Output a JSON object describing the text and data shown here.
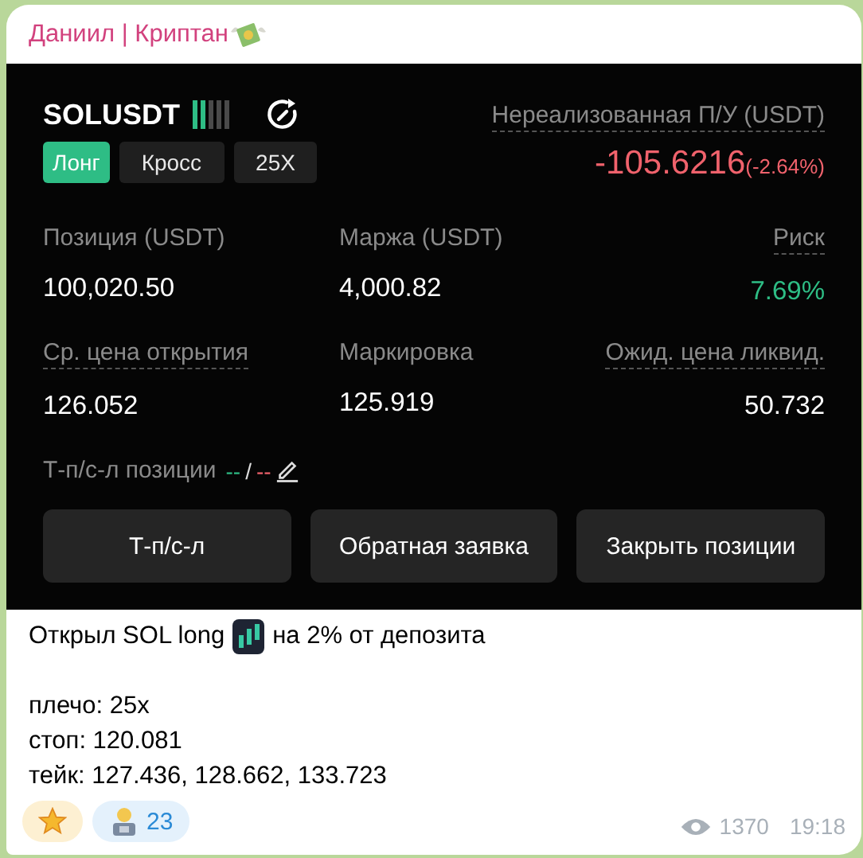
{
  "channel": {
    "name": "Даниил | Криптан"
  },
  "position": {
    "symbol": "SOLUSDT",
    "level": 0.4,
    "tags": [
      {
        "label": "Лонг",
        "kind": "side"
      },
      {
        "label": "Кросс",
        "kind": "plain"
      },
      {
        "label": "25X",
        "kind": "plain"
      }
    ],
    "pnl_label": "Нереализованная П/У (USDT)",
    "pnl_value": "-105.6216",
    "pnl_percent": "(-2.64%)",
    "stats": [
      {
        "label": "Позиция (USDT)",
        "value": "100,020.50",
        "dotted": false,
        "color": "#ffffff"
      },
      {
        "label": "Маржа (USDT)",
        "value": "4,000.82",
        "dotted": false,
        "color": "#ffffff"
      },
      {
        "label": "Риск",
        "value": "7.69%",
        "dotted": true,
        "color": "#2ebd85"
      },
      {
        "label": "Ср. цена открытия",
        "value": "126.052",
        "dotted": true,
        "color": "#ffffff"
      },
      {
        "label": "Маркировка",
        "value": "125.919",
        "dotted": false,
        "color": "#ffffff"
      },
      {
        "label": "Ожид. цена ликвид.",
        "value": "50.732",
        "dotted": true,
        "color": "#ffffff"
      }
    ],
    "tpsl": {
      "label": "Т-п/с-л позиции",
      "take": "--",
      "separator": "/",
      "stop": "--"
    },
    "buttons": [
      "Т-п/с-л",
      "Обратная заявка",
      "Закрыть позиции"
    ]
  },
  "message": {
    "first_before": "Открыл SOL long",
    "first_after": "на 2% от депозита",
    "lines": [
      "плечо: 25x",
      "стоп: 120.081",
      "тейк: 127.436, 128.662, 133.723"
    ]
  },
  "reactions": [
    {
      "kind": "star"
    },
    {
      "kind": "person",
      "count": "23"
    }
  ],
  "footer": {
    "views": "1370",
    "time": "19:18"
  }
}
